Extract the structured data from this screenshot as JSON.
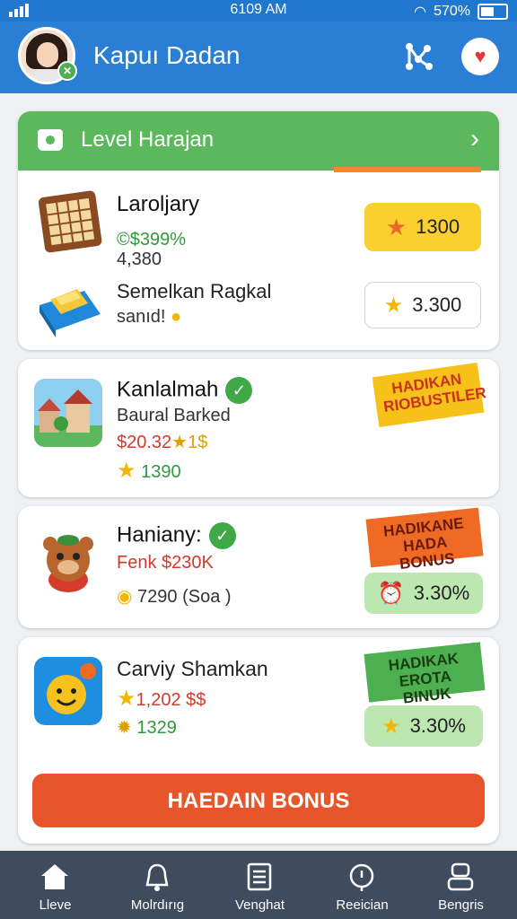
{
  "status_bar": {
    "time": "6109 AM",
    "battery": "570%"
  },
  "header": {
    "title": "Kapuı Dadan"
  },
  "level_card": {
    "title": "Level Harajan",
    "items": [
      {
        "name": "Laroljary",
        "line1": "©$399%",
        "line2": "4,380",
        "reward": "1300"
      },
      {
        "name": "Semelkan Ragkal",
        "line1": "sanıd!",
        "reward": "3.300"
      }
    ]
  },
  "offers": [
    {
      "name": "Kanlalmah",
      "subtitle": "Baural Barked",
      "price": "$20.32",
      "price_suffix": "★1$",
      "points": "1390",
      "promo": "HADIKAN RIOBUSTILER"
    },
    {
      "name": "Haniany:",
      "subtitle": "Fenk $230K",
      "points": "7290",
      "points_note": "(Soa )",
      "promo": "HADIKANE HADA BONUS",
      "reward": "3.30%"
    },
    {
      "name": "Carviy Shamkan",
      "price": "1,202 $$",
      "points": "1329",
      "promo": "HADIKAK EROTA BINUK",
      "reward": "3.30%"
    }
  ],
  "bonus_button": "HAEDAIN BONUS",
  "nav": [
    {
      "label": "Lleve",
      "icon": "home-icon"
    },
    {
      "label": "Molrdırıg",
      "icon": "bell-icon"
    },
    {
      "label": "Venghat",
      "icon": "list-icon"
    },
    {
      "label": "Reeician",
      "icon": "compass-icon"
    },
    {
      "label": "Bengris",
      "icon": "profile-icon"
    }
  ],
  "colors": {
    "app_bar": "#2a7fd4",
    "level_header": "#5cb85c",
    "bonus_button": "#e8552a",
    "nav_bar": "#3f4c5f"
  }
}
